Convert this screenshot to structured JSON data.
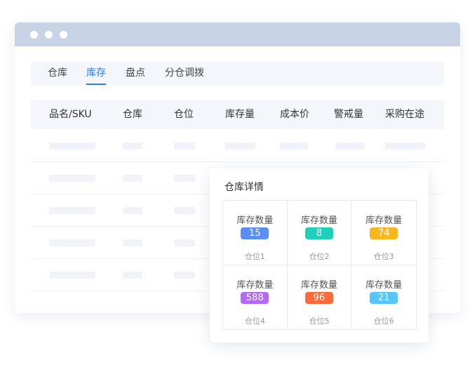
{
  "tabs": [
    "仓库",
    "库存",
    "盘点",
    "分仓调拨"
  ],
  "active_tab": "库存",
  "table": {
    "headers": [
      "品名/SKU",
      "仓库",
      "仓位",
      "库存量",
      "成本价",
      "警戒量",
      "采购在途"
    ]
  },
  "detail": {
    "title": "仓库详情",
    "cells": [
      {
        "label": "库存数量",
        "value": "15",
        "location": "仓位1",
        "color": "#5b8ef5"
      },
      {
        "label": "库存数量",
        "value": "8",
        "location": "仓位2",
        "color": "#1fcfb8"
      },
      {
        "label": "库存数量",
        "value": "74",
        "location": "仓位3",
        "color": "#f7b71d"
      },
      {
        "label": "库存数量",
        "value": "588",
        "location": "仓位4",
        "color": "#b36af5"
      },
      {
        "label": "库存数量",
        "value": "96",
        "location": "仓位5",
        "color": "#fb6a3b"
      },
      {
        "label": "库存数量",
        "value": "21",
        "location": "仓位6",
        "color": "#55c6f7"
      }
    ]
  },
  "colors": {
    "accent": "#2f7bf5",
    "titlebar": "#c9d3e6"
  }
}
